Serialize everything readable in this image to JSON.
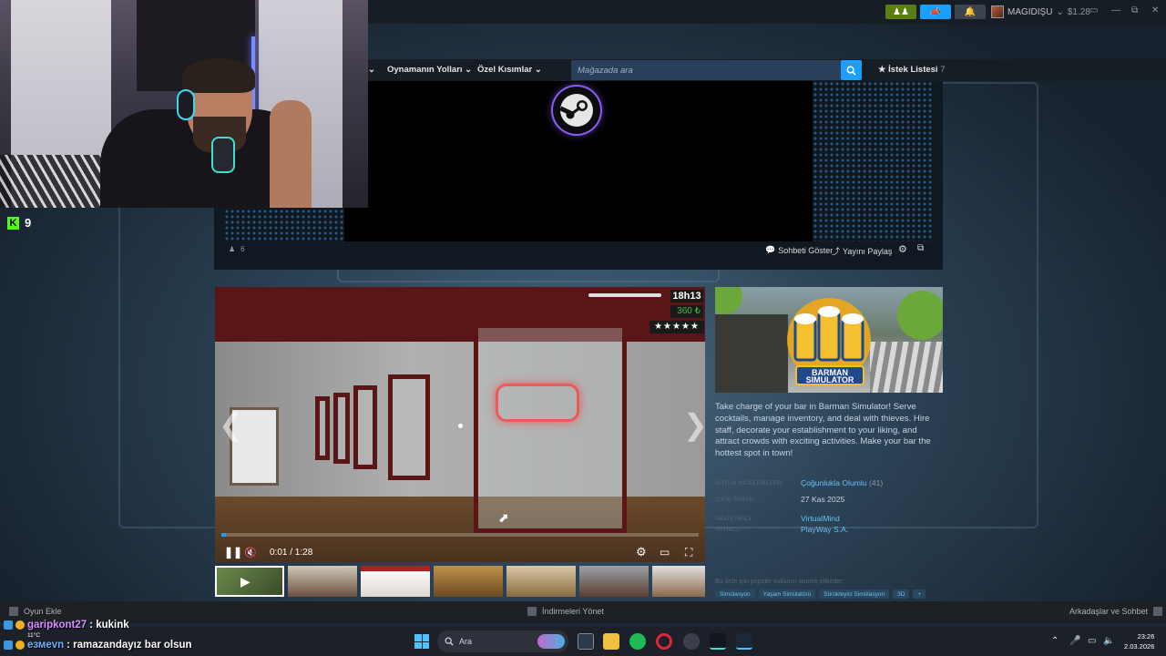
{
  "topbar": {
    "username": "MAGIDIŞU",
    "balance": "$1.28"
  },
  "nav": {
    "items": [
      "Oynamanın Yolları",
      "Özel Kısımlar"
    ],
    "search_placeholder": "Mağazada ara",
    "wishlist_label": "İstek Listesi",
    "wishlist_count": "7"
  },
  "broadcast": {
    "viewers": "6",
    "show_chat": "Sohbeti Göster",
    "share_stream": "Yayını Paylaş"
  },
  "webcam": {
    "kick_count": "9"
  },
  "player": {
    "hud_time": "18h13",
    "hud_money": "360 ₺",
    "hud_stars": "★★★★★",
    "time": "0:01 / 1:28",
    "progress": 0.01
  },
  "game": {
    "capsule_title": "BARMAN SIMULATOR",
    "description": "Take charge of your bar in Barman Simulator! Serve cocktails, manage inventory, and deal with thieves. Hire staff, decorate your establishment to your liking, and attract crowds with exciting activities. Make your bar the hottest spot in town!",
    "reviews_label": "BÜTÜN İNCELEMELER:",
    "reviews_value": "Çoğunlukla Olumlu",
    "reviews_count": "(41)",
    "release_label": "ÇIKIŞ TARİHİ:",
    "release_value": "27 Kas 2025",
    "developer_label": "GELİŞTİRİCİ:",
    "developer_value": "VirtualMind",
    "publisher_label": "YAYINCI:",
    "publisher_value": "PlayWay S.A.",
    "tags_title": "Bu ürün için popüler kullanıcı tanımlı etiketler:",
    "tags": [
      "Simülasyon",
      "Yaşam Simülatörü",
      "Sürükleyici Simülasyon",
      "3D",
      "+"
    ]
  },
  "steam_bottom": {
    "add_game": "Oyun Ekle",
    "downloads": "İndirmeleri Yönet",
    "friends_chat": "Arkadaşlar ve Sohbet"
  },
  "chat": [
    {
      "user": "garipkont27",
      "message": ": kukink"
    },
    {
      "user": "езмеvn",
      "message": ": ramazandayız bar olsun"
    }
  ],
  "taskbar": {
    "search_label": "Ara",
    "time": "23:26",
    "date": "2.03.2026",
    "weather": "11°C"
  },
  "colors": {
    "steam_bg": "#1b2838",
    "accent_blue": "#1a9fff",
    "link_blue": "#66c0f4",
    "kick_green": "#53fc18"
  }
}
